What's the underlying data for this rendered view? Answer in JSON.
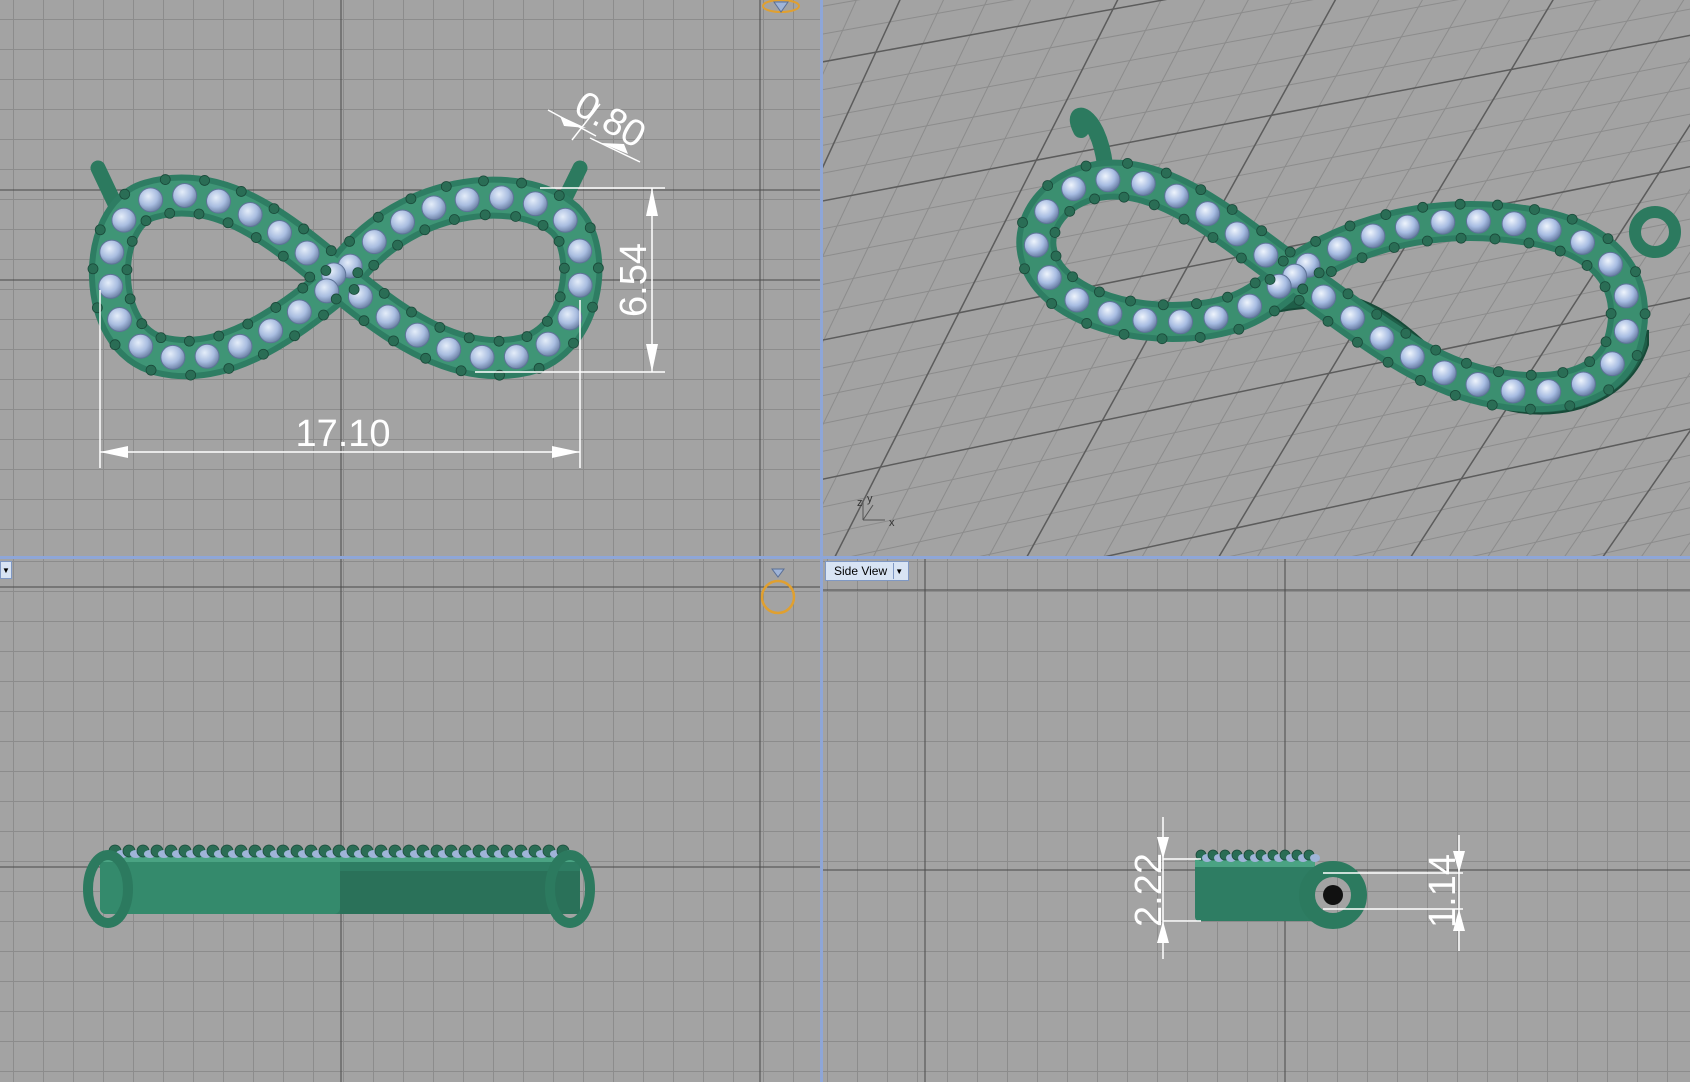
{
  "viewports": {
    "top": {
      "dimensions": {
        "width": "17.10",
        "height": "6.54",
        "bail_diameter": "0.80"
      }
    },
    "perspective": {
      "axis_labels": {
        "x": "x",
        "y": "y",
        "z": "z"
      }
    },
    "front": {},
    "side": {
      "label": "Side View",
      "dimensions": {
        "total_height": "2.22",
        "band_height": "1.14"
      }
    }
  },
  "colors": {
    "viewport_bg": "#a3a3a3",
    "grid": "#8c8c8c",
    "splitter": "#8ea6d8",
    "metal": "#2e7d63",
    "stone": "#a9bde0",
    "dimension": "#ffffff",
    "ring_icon": "#e0a030"
  },
  "icons": [
    "diamond-icon",
    "ring-icon",
    "axis-triad-icon",
    "chevron-down-icon"
  ]
}
